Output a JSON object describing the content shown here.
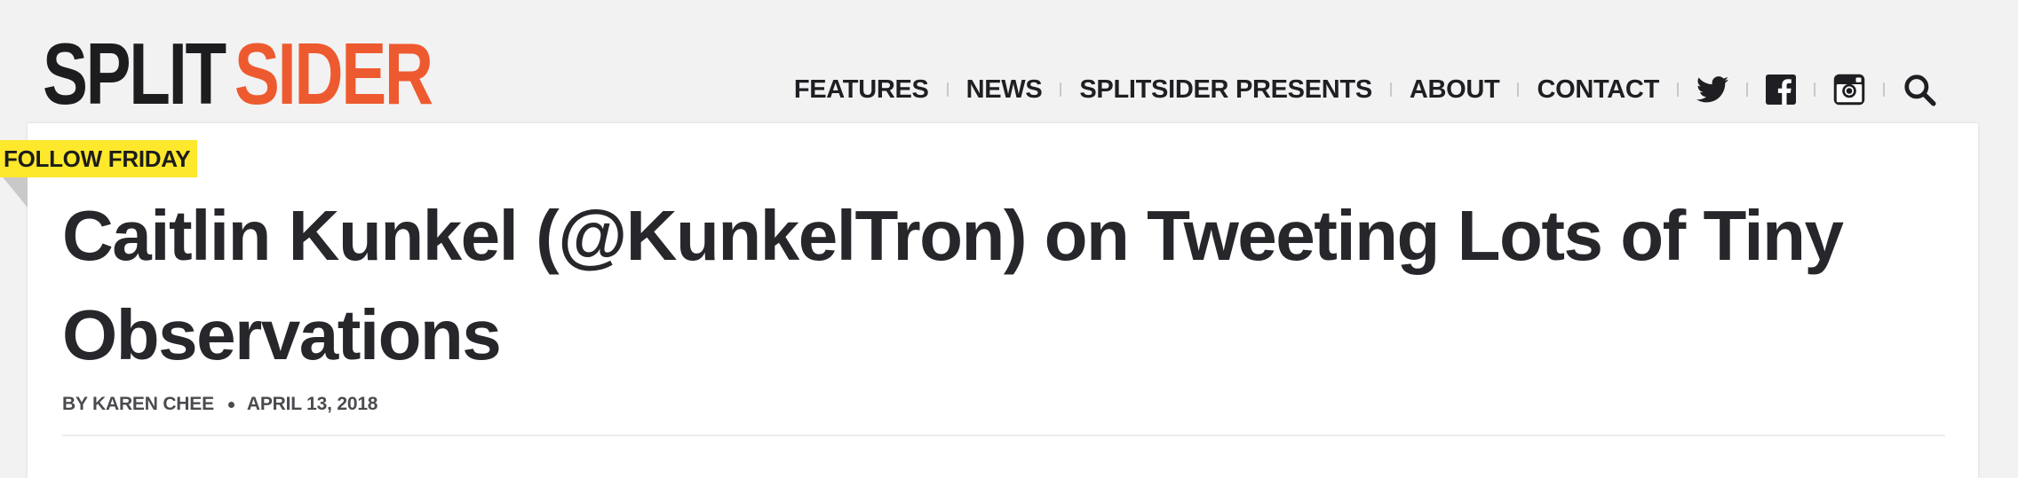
{
  "brand": {
    "logo_part1": "SPLIT",
    "logo_part2": "SIDER",
    "accent_color": "#ee5a2f"
  },
  "nav": {
    "items": [
      {
        "label": "FEATURES"
      },
      {
        "label": "NEWS"
      },
      {
        "label": "SPLITSIDER PRESENTS"
      },
      {
        "label": "ABOUT"
      },
      {
        "label": "CONTACT"
      }
    ],
    "icons": [
      "twitter-icon",
      "facebook-icon",
      "instagram-icon",
      "search-icon"
    ]
  },
  "article": {
    "category": "FOLLOW FRIDAY",
    "category_color": "#fde82b",
    "title": "Caitlin Kunkel (@KunkelTron) on Tweeting Lots of Tiny Observations",
    "byline": "BY KAREN CHEE",
    "date": "APRIL 13, 2018"
  }
}
